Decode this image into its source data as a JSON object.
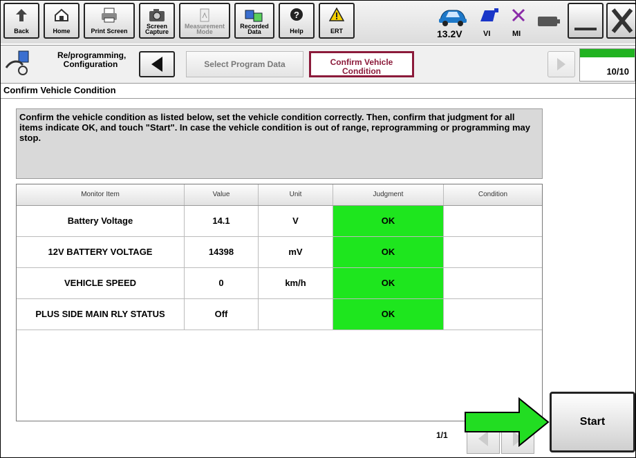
{
  "toolbar": {
    "back": "Back",
    "home": "Home",
    "print_screen": "Print Screen",
    "screen_capture": "Screen Capture",
    "measurement_mode": "Measurement Mode",
    "recorded_data": "Recorded Data",
    "help": "Help",
    "ert": "ERT",
    "voltage": "13.2V",
    "vi": "VI",
    "mi": "MI"
  },
  "steps": {
    "section_label": "Re/programming, Configuration",
    "previous": "Select Program Data",
    "current": "Confirm Vehicle Condition",
    "progress_text": "10/10",
    "progress_fraction": 1.0
  },
  "section_title": "Confirm Vehicle Condition",
  "instruction": "Confirm the vehicle condition as listed below, set the vehicle condition correctly. Then, confirm that judgment for all items indicate OK, and touch \"Start\". In case the vehicle condition is out of range, reprogramming or programming may stop.",
  "table": {
    "headers": [
      "Monitor Item",
      "Value",
      "Unit",
      "Judgment",
      "Condition"
    ],
    "rows": [
      {
        "item": "Battery Voltage",
        "value": "14.1",
        "unit": "V",
        "judgment": "OK",
        "condition": ""
      },
      {
        "item": "12V BATTERY VOLTAGE",
        "value": "14398",
        "unit": "mV",
        "judgment": "OK",
        "condition": ""
      },
      {
        "item": "VEHICLE SPEED",
        "value": "0",
        "unit": "km/h",
        "judgment": "OK",
        "condition": ""
      },
      {
        "item": "PLUS SIDE MAIN RLY STATUS",
        "value": "Off",
        "unit": "",
        "judgment": "OK",
        "condition": ""
      }
    ]
  },
  "pagination": {
    "text": "1/1"
  },
  "start_label": "Start",
  "colors": {
    "ok": "#1ee61e",
    "current_step": "#8b1a3a",
    "progress": "#21b321",
    "arrow": "#22dd22"
  }
}
